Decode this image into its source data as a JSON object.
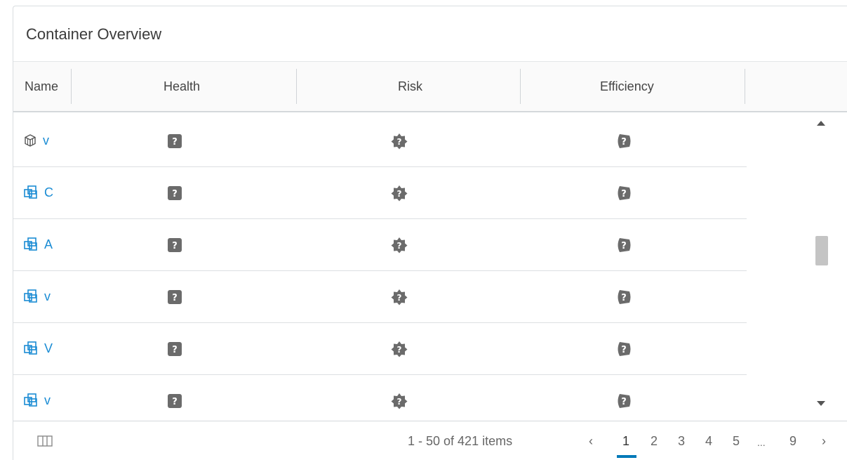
{
  "card": {
    "title": "Container Overview"
  },
  "columns": {
    "name": "Name",
    "health": "Health",
    "risk": "Risk",
    "efficiency": "Efficiency"
  },
  "icons": {
    "health": "unknown-health-icon",
    "risk": "unknown-risk-icon",
    "efficiency": "unknown-efficiency-icon",
    "colors": {
      "status_gray": "#6b6b6b",
      "link_blue": "#1b8cd4",
      "accent": "#0079b8"
    }
  },
  "rows": [
    {
      "icon": "datacenter-icon",
      "name": "v"
    },
    {
      "icon": "cluster-icon",
      "name": "C"
    },
    {
      "icon": "cluster-icon",
      "name": "A"
    },
    {
      "icon": "cluster-icon",
      "name": "v"
    },
    {
      "icon": "cluster-icon",
      "name": "V"
    },
    {
      "icon": "cluster-icon",
      "name": "v"
    }
  ],
  "footer": {
    "items_text": "1 - 50 of 421 items",
    "prev": "‹",
    "next": "›",
    "pages": [
      "1",
      "2",
      "3",
      "4",
      "5",
      "...",
      "9"
    ],
    "current_page": "1"
  }
}
